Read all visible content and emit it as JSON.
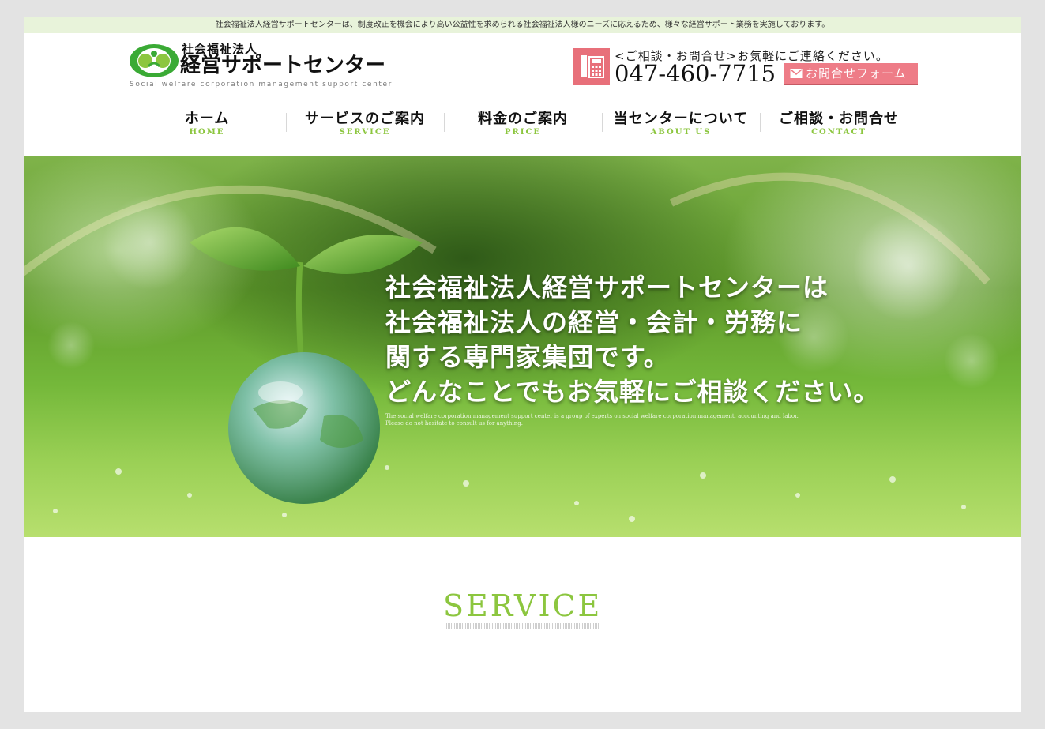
{
  "topbar": {
    "text": "社会福祉法人経営サポートセンターは、制度改正を機会により高い公益性を求められる社会福祉法人様のニーズに応えるため、様々な経営サポート業務を実施しております。"
  },
  "logo": {
    "small": "社会福祉法人",
    "main": "経営サポートセンター",
    "english": "Social welfare corporation management support center"
  },
  "contact": {
    "lead": "<ご相談・お問合せ>お気軽にご連絡ください。",
    "phone": "047-460-7715",
    "form_button": "お問合せフォーム"
  },
  "nav": {
    "items": [
      {
        "jp": "ホーム",
        "en": "HOME"
      },
      {
        "jp": "サービスのご案内",
        "en": "SERVICE"
      },
      {
        "jp": "料金のご案内",
        "en": "PRICE"
      },
      {
        "jp": "当センターについて",
        "en": "ABOUT US"
      },
      {
        "jp": "ご相談・お問合せ",
        "en": "CONTACT"
      }
    ]
  },
  "hero": {
    "lines": [
      "社会福祉法人経営サポートセンターは",
      "社会福祉法人の経営・会計・労務に",
      "関する専門家集団です。",
      "どんなことでもお気軽にご相談ください。"
    ],
    "english_1": "The social welfare corporation management support center is a group of experts on social welfare corporation management, accounting and labor.",
    "english_2": "Please do not hesitate to consult us for anything."
  },
  "service": {
    "title": "SERVICE"
  },
  "colors": {
    "accent_green": "#8cc63f",
    "pink": "#ee7c87",
    "topbar_bg": "#e8f3da"
  }
}
